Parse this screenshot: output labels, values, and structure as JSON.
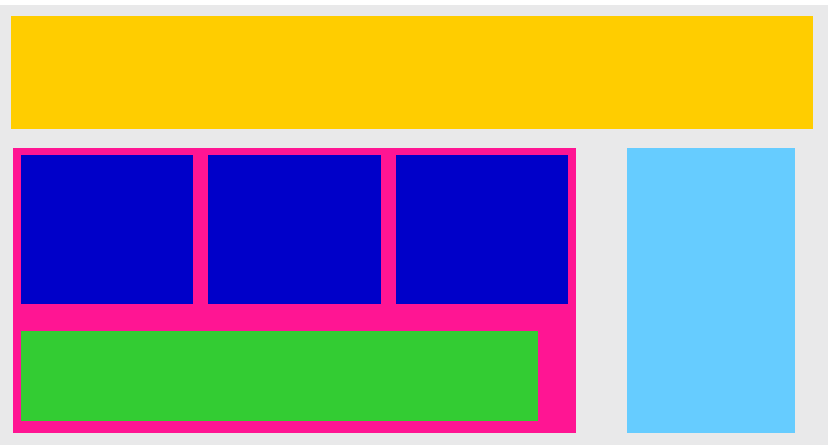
{
  "colors": {
    "page_background": "#ffffff",
    "frame_background": "#e9e9ea",
    "header": "#ffcd00",
    "main_panel": "#ff1593",
    "tile": "#0000c9",
    "footer_block": "#33cc33",
    "sidebar": "#66ccff"
  },
  "layout_blocks": {
    "header": "",
    "main_panel": "",
    "tiles": [
      "",
      "",
      ""
    ],
    "footer_block": "",
    "sidebar": ""
  }
}
